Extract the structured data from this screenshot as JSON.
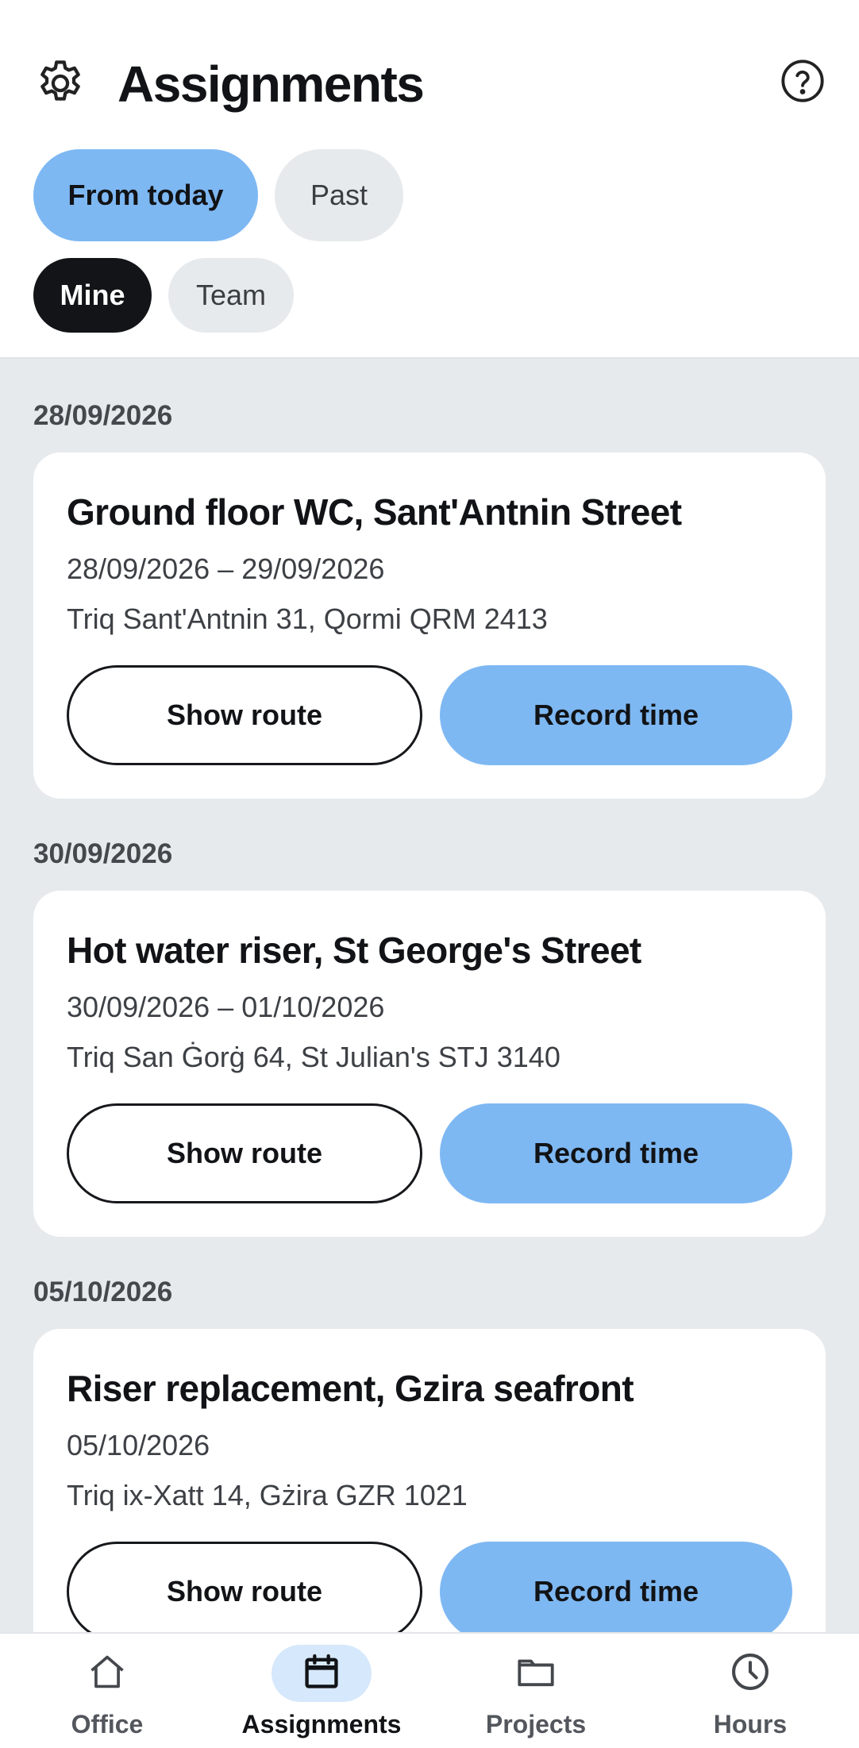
{
  "header": {
    "title": "Assignments",
    "settings_icon": "gear-icon",
    "help_icon": "help-circle-icon"
  },
  "time_filter": {
    "options": [
      {
        "label": "From today",
        "selected": true
      },
      {
        "label": "Past",
        "selected": false
      }
    ]
  },
  "scope_filter": {
    "options": [
      {
        "label": "Mine",
        "selected": true
      },
      {
        "label": "Team",
        "selected": false
      }
    ]
  },
  "groups": [
    {
      "date": "28/09/2026",
      "card": {
        "title": "Ground floor WC, Sant'Antnin Street",
        "dates": "28/09/2026 – 29/09/2026",
        "address": "Triq Sant'Antnin 31, Qormi QRM 2413",
        "route_label": "Show route",
        "record_label": "Record time"
      }
    },
    {
      "date": "30/09/2026",
      "card": {
        "title": "Hot water riser, St George's Street",
        "dates": "30/09/2026 – 01/10/2026",
        "address": "Triq San Ġorġ 64, St Julian's STJ 3140",
        "route_label": "Show route",
        "record_label": "Record time"
      }
    },
    {
      "date": "05/10/2026",
      "card": {
        "title": "Riser replacement, Gzira seafront",
        "dates": "05/10/2026",
        "address": "Triq ix-Xatt 14, Gżira GZR 1021",
        "route_label": "Show route",
        "record_label": "Record time"
      }
    }
  ],
  "bottom_nav": {
    "items": [
      {
        "label": "Office",
        "icon": "home-icon",
        "active": false
      },
      {
        "label": "Assignments",
        "icon": "calendar-icon",
        "active": true
      },
      {
        "label": "Projects",
        "icon": "folder-icon",
        "active": false
      },
      {
        "label": "Hours",
        "icon": "clock-icon",
        "active": false
      }
    ]
  },
  "colors": {
    "accent": "#7eb8f3",
    "accent_soft": "#d6e8fb",
    "dark_chip": "#121417",
    "neutral_chip": "#e7eaed",
    "list_background": "#e7eaed"
  }
}
